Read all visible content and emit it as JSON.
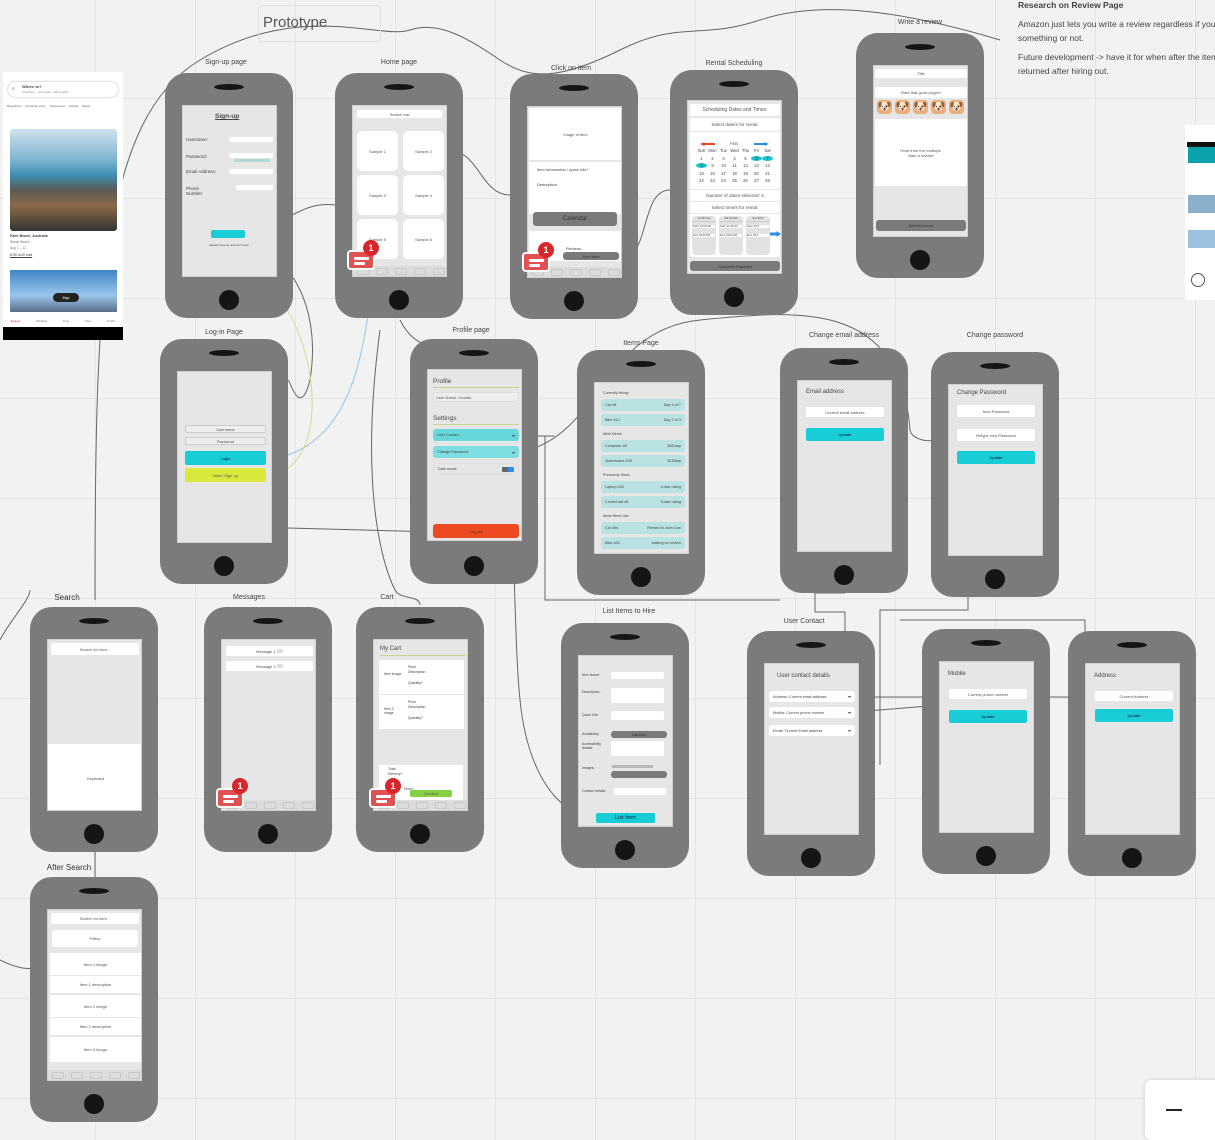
{
  "board": {
    "title": "Prototype",
    "research": {
      "heading": "Research on Review Page",
      "p1": "Amazon just lets you write a review regardless if you've bought something or not.",
      "p2": "Future development -> have it for when after the item has been returned after hiring out."
    }
  },
  "airbnb": {
    "search_title": "Where to?",
    "search_sub": "Anywhere · Any week · Add guests",
    "categories": [
      "Beachfront",
      "Amazing pools",
      "Treehouses",
      "Islands",
      "Boats"
    ],
    "listing_title": "Palm Beach, Australia",
    "listing_sub": "Whale Beach",
    "listing_dates": "Aug 7 – 12",
    "listing_price": "$780 AUD total",
    "map_button": "Map",
    "nav": [
      "Explore",
      "Wishlists",
      "Trips",
      "Inbox",
      "Profile"
    ]
  },
  "phones": {
    "signup": {
      "title": "Sign-up page",
      "heading": "Sign-up",
      "username": "Username:",
      "password": "Password:",
      "email": "Email Address:",
      "phone": "Phone Number:",
      "login_link": "Already have an account? Login"
    },
    "home": {
      "title": "Home page",
      "search": "Search bar",
      "samples": [
        "Sample 1",
        "Sample 2",
        "Sample 3",
        "Sample 4",
        "Sample 5",
        "Sample 6"
      ],
      "badge": "1"
    },
    "item": {
      "title": "Click on item",
      "image": "Image of item",
      "info": "Item Information / quick info?",
      "description": "Description",
      "calendar": "Calendar",
      "reviews": "Reviews",
      "rent": "Rent item",
      "badge": "1"
    },
    "rental": {
      "title": "Rental Scheduling",
      "header": "Scheduling Dates and Times:",
      "select_dates": "Select date/s for rental:",
      "month": "FEB",
      "weekdays": [
        "Sun",
        "Mon",
        "Tue",
        "Wed",
        "Thu",
        "Fri",
        "Sat"
      ],
      "days": [
        "1",
        "2",
        "3",
        "4",
        "5",
        "6",
        "7",
        "8",
        "9",
        "10",
        "11",
        "12",
        "13",
        "14",
        "15",
        "16",
        "17",
        "18",
        "19",
        "20",
        "21",
        "22",
        "23",
        "24",
        "25",
        "26",
        "27",
        "28"
      ],
      "selected_days": [
        "6",
        "7",
        "8"
      ],
      "count": "Number of dates selected: 3",
      "select_times": "Select time/s for rental:",
      "slots": [
        {
          "day": "Fri 6th Feb",
          "start": "Start: 10:00 AM",
          "end": "End: 05:30 PM"
        },
        {
          "day": "Sat 7th Feb",
          "start": "Start: 11:45 AM",
          "end": "End: 03:00 AM"
        },
        {
          "day": "Sun 8th F",
          "start": "Start: 10:0",
          "end": "End: 05:4"
        }
      ],
      "pay": "Complete Payment"
    },
    "review": {
      "title": "Write a review",
      "field_title": "Title",
      "rate": "Rate that good pupper",
      "prompt1": "Howl from the rooftops.",
      "prompt2": "Bark a review!",
      "submit": "Submit review"
    },
    "login": {
      "title": "Log-in Page",
      "username": "Username",
      "password": "Password",
      "login": "Login",
      "signup": "New? Sign up"
    },
    "profile": {
      "title": "Profile page",
      "heading": "Profile",
      "username": "User Name: Gozilla",
      "settings": "Settings",
      "contact": "User Contact",
      "change_pw": "Change Password",
      "dark": "Dark mode",
      "logout": "Log out"
    },
    "items": {
      "title": "Items Page",
      "sections": [
        {
          "label": "Currently Hiring:",
          "rows": [
            [
              "Car #8",
              "Day 4 of 7"
            ],
            [
              "Bike #12",
              "Day 2 of 3"
            ]
          ]
        },
        {
          "label": "Wish Direct:",
          "rows": [
            [
              "Computer #5",
              "$50/day"
            ],
            [
              "Skateboard #28",
              "$15/day"
            ]
          ]
        },
        {
          "label": "Previously Hired:",
          "rows": [
            [
              "Laptop #30",
              "4-star rating"
            ],
            [
              "Cricket bat #6",
              "5-star rating"
            ]
          ]
        },
        {
          "label": "Items Hired Out:",
          "rows": [
            [
              "Car #9s",
              "Rented to John Doe"
            ],
            [
              "Bike #32",
              "waiting for review"
            ]
          ]
        }
      ]
    },
    "change_email": {
      "title": "Change email address",
      "heading": "Email address",
      "input": "Current email address",
      "update": "Update"
    },
    "change_pw": {
      "title": "Change password",
      "heading": "Change Password",
      "new_pw": "New Password",
      "retype": "Retype new Password",
      "update": "Update"
    },
    "search": {
      "title": "Search",
      "placeholder": "Search for item...",
      "keyboard": "Keyboard"
    },
    "messages": {
      "title": "Messages",
      "items": [
        "Message 1",
        "Message 2"
      ],
      "badge": "1"
    },
    "cart": {
      "title": "Cart",
      "heading": "My Cart",
      "items": [
        {
          "img": "Item image",
          "price": "Price",
          "desc": "Description",
          "qty": "Quantity?"
        },
        {
          "img": "Item 2 image",
          "price": "Price",
          "desc": "Description",
          "qty": "Quantity?"
        }
      ],
      "total": "Total:",
      "delivery": "Delivery?",
      "fees": "Fees?",
      "checkout": "Checkout",
      "badge": "1"
    },
    "list_item": {
      "title": "List Items to Hire",
      "name": "Item Name:",
      "desc": "Description:",
      "quick": "Quick Info:",
      "avail": "Availability:",
      "calendar": "Calendar",
      "access": "Accessibility details:",
      "images": "Images:",
      "contact": "Contact details:",
      "submit": "List Item"
    },
    "contact": {
      "title": "User Contact",
      "heading": "User contact details",
      "rows": [
        "Address: Current email address",
        "Mobile: Current phone number",
        "Email: Current Email address"
      ]
    },
    "mobile": {
      "title": "",
      "heading": "Mobile",
      "input": "Current phone number",
      "update": "Update"
    },
    "address": {
      "title": "",
      "heading": "Address",
      "input": "Current Address",
      "update": "Update"
    },
    "after": {
      "title": "After Search",
      "placeholder": "Search for item...",
      "filters": "Filters",
      "items": [
        "Item 1 image",
        "Item 1 description",
        "Item 2 image",
        "Item 2 description",
        "Item 3 image"
      ]
    }
  }
}
